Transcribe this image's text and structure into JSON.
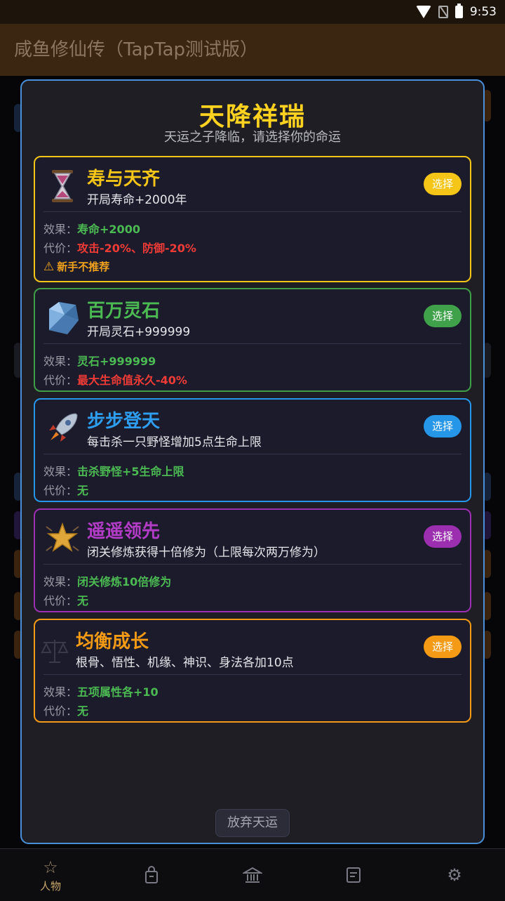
{
  "status_bar": {
    "time": "9:53"
  },
  "app_title": "咸鱼修仙传（TapTap测试版）",
  "dialog": {
    "title": "天降祥瑞",
    "subtitle": "天运之子降临，请选择你的命运",
    "abandon_label": "放弃天运",
    "effect_label": "效果：",
    "cost_label": "代价：",
    "select_label": "选择",
    "options": [
      {
        "name": "寿与天齐",
        "desc": "开局寿命+2000年",
        "effect": "寿命+2000",
        "cost": "攻击-20%、防御-20%",
        "warning": "新手不推荐",
        "color": "#f5c518",
        "name_color": "#f5c518",
        "icon": "hourglass-icon"
      },
      {
        "name": "百万灵石",
        "desc": "开局灵石+999999",
        "effect": "灵石+999999",
        "cost": "最大生命值永久-40%",
        "color": "#3f9f47",
        "name_color": "#4cba52",
        "icon": "diamond-icon"
      },
      {
        "name": "步步登天",
        "desc": "每击杀一只野怪增加5点生命上限",
        "effect": "击杀野怪+5生命上限",
        "cost": "无",
        "color": "#2596e8",
        "name_color": "#2e9ef0",
        "icon": "rocket-icon"
      },
      {
        "name": "遥遥领先",
        "desc": "闭关修炼获得十倍修为（上限每次两万修为）",
        "effect": "闭关修炼10倍修为",
        "cost": "无",
        "color": "#9b2fb0",
        "name_color": "#b23cc6",
        "icon": "star-icon"
      },
      {
        "name": "均衡成长",
        "desc": "根骨、悟性、机缘、神识、身法各加10点",
        "effect": "五项属性各+10",
        "cost": "无",
        "color": "#f59a14",
        "name_color": "#f59a14",
        "icon": "scales-icon"
      }
    ]
  },
  "nav": {
    "active_label": "人物"
  }
}
